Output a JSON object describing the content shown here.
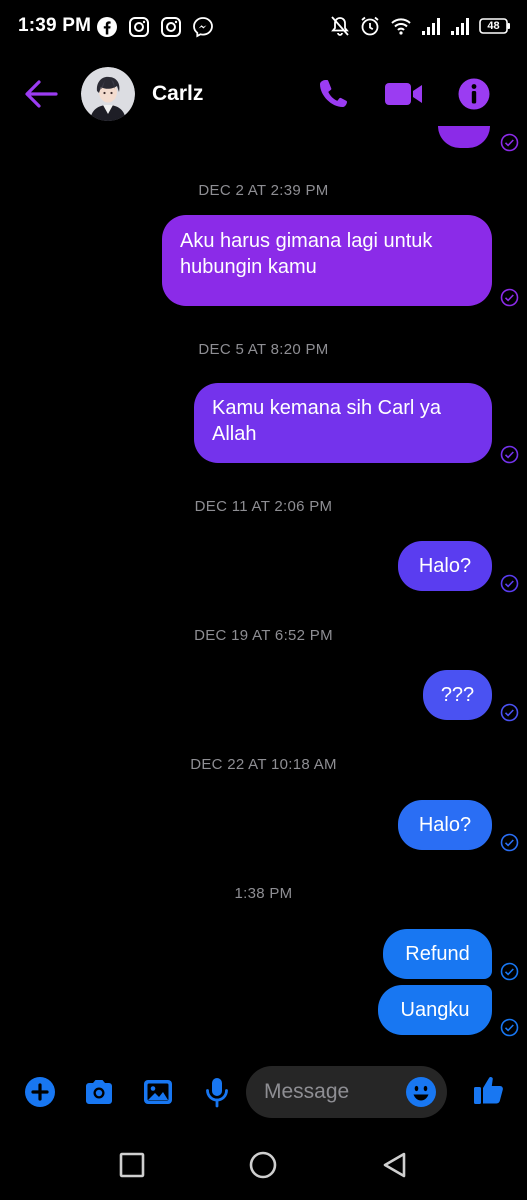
{
  "status_bar": {
    "time": "1:39 PM",
    "app_icons": [
      "facebook-icon",
      "instagram-icon",
      "instagram-icon",
      "messenger-icon"
    ],
    "system_icons": [
      "notifications-off-icon",
      "alarm-icon",
      "wifi-icon",
      "signal-icon",
      "signal-icon",
      "battery-icon"
    ],
    "battery": "48"
  },
  "header": {
    "contact_name": "Carlz",
    "back_icon": "arrow-left-icon",
    "actions": [
      "phone-icon",
      "video-camera-icon",
      "info-icon"
    ]
  },
  "colors": {
    "purple": "#8b2be8",
    "violet": "#7433ec",
    "indigo": "#5a3df0",
    "blue": "#1877f2",
    "timestamp": "#8e8e93",
    "background": "#000000"
  },
  "conversation": {
    "timestamps": [
      "DEC 2 AT 2:39 PM",
      "DEC 5 AT 8:20 PM",
      "DEC 11 AT 2:06 PM",
      "DEC 19 AT 6:52 PM",
      "DEC 22 AT 10:18 AM",
      "1:38 PM"
    ],
    "messages": [
      {
        "text": "Aku harus gimana lagi untuk hubungin kamu",
        "status": "sent"
      },
      {
        "text": "Kamu kemana sih Carl ya Allah",
        "status": "sent"
      },
      {
        "text": "Halo?",
        "status": "sent"
      },
      {
        "text": "???",
        "status": "sent"
      },
      {
        "text": "Halo?",
        "status": "sent"
      },
      {
        "text": "Refund",
        "status": "sent"
      },
      {
        "text": "Uangku",
        "status": "sent"
      }
    ]
  },
  "composer": {
    "placeholder": "Message",
    "actions": [
      "plus-icon",
      "camera-icon",
      "image-icon",
      "microphone-icon"
    ],
    "emoji_icon": "emoji-icon",
    "like_icon": "thumbs-up-icon"
  },
  "nav_bar": {
    "buttons": [
      "recents-square-icon",
      "home-circle-icon",
      "back-triangle-icon"
    ]
  }
}
